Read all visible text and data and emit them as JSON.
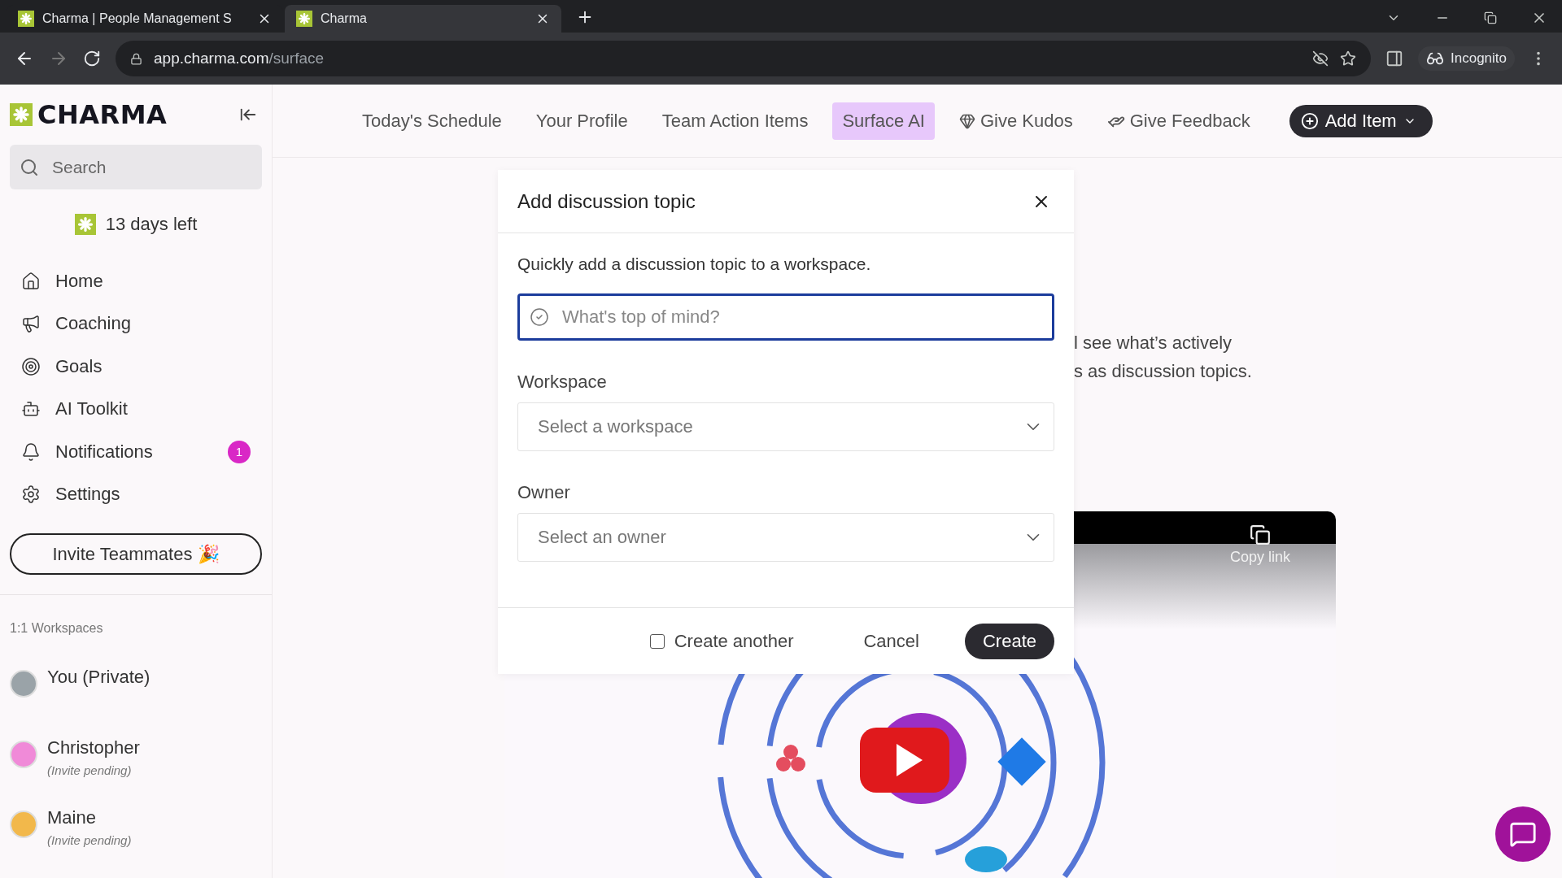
{
  "browser": {
    "tabs": [
      {
        "title": "Charma | People Management S",
        "selected": false
      },
      {
        "title": "Charma",
        "selected": true
      }
    ],
    "url_host": "app.charma.com",
    "url_path": "/surface",
    "profile": "Incognito"
  },
  "sidebar": {
    "logo": "CHARMA",
    "search": {
      "placeholder": "Search"
    },
    "trial": "13 days left",
    "items": [
      {
        "label": "Home"
      },
      {
        "label": "Coaching"
      },
      {
        "label": "Goals"
      },
      {
        "label": "AI Toolkit"
      },
      {
        "label": "Notifications",
        "badge": "1"
      },
      {
        "label": "Settings"
      }
    ],
    "invite_button": "Invite Teammates 🎉",
    "section_title": "1:1 Workspaces",
    "workspaces": [
      {
        "name": "You (Private)",
        "color": "#9aa3a8"
      },
      {
        "name": "Christopher",
        "note": "(Invite pending)",
        "color": "#f08ad8"
      },
      {
        "name": "Maine",
        "note": "(Invite pending)",
        "color": "#f2b84b"
      }
    ]
  },
  "top_nav": {
    "items": [
      {
        "label": "Today's Schedule",
        "selected": false
      },
      {
        "label": "Your Profile",
        "selected": false
      },
      {
        "label": "Team Action Items",
        "selected": false
      },
      {
        "label": "Surface AI",
        "selected": true
      },
      {
        "label": "Give Kudos",
        "selected": false
      },
      {
        "label": "Give Feedback",
        "selected": false
      }
    ],
    "add_button": "Add Item"
  },
  "background": {
    "lines": [
      "l see what’s actively",
      "s as discussion topics."
    ],
    "copy_link": "Copy link"
  },
  "dialog": {
    "title": "Add discussion topic",
    "description": "Quickly add a discussion topic to a workspace.",
    "topic": {
      "placeholder": "What's top of mind?"
    },
    "fields": [
      {
        "label": "Workspace",
        "placeholder": "Select a workspace"
      },
      {
        "label": "Owner",
        "placeholder": "Select an owner"
      }
    ],
    "create_another": {
      "label": "Create another",
      "checked": false
    },
    "cancel": "Cancel",
    "create": "Create"
  }
}
